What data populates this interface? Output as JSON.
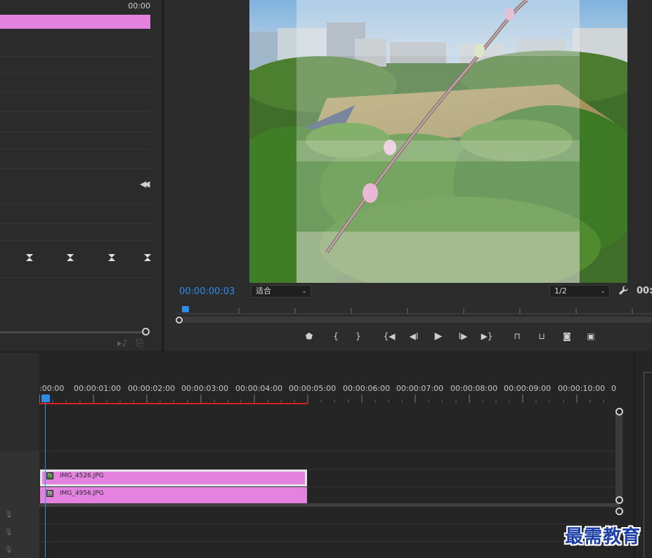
{
  "source_panel": {
    "timecode": "00:00"
  },
  "program_monitor": {
    "timecode": "00:00:00:03",
    "zoom": "适合",
    "resolution": "1/2",
    "duration_partial": "00:",
    "preview_image": "campus-sports-field-with-flower-branch-overlay",
    "transport_icons": [
      "add-marker-icon",
      "mark-in-icon",
      "mark-out-icon",
      "go-to-in-icon",
      "step-back-icon",
      "play-icon",
      "step-forward-icon",
      "go-to-out-icon",
      "lift-icon",
      "extract-icon",
      "export-frame-icon",
      "compare-view-icon"
    ]
  },
  "timeline": {
    "ruler_labels": [
      ":00:00",
      "00:00:01:00",
      "00:00:02:00",
      "00:00:03:00",
      "00:00:04:00",
      "00:00:05:00",
      "00:00:06:00",
      "00:00:07:00",
      "00:00:08:00",
      "00:00:09:00",
      "00:00:10:00",
      "0"
    ],
    "clips": [
      {
        "name": "IMG_4526.JPG",
        "color": "#e483df"
      },
      {
        "name": "IMG_4956.JPG",
        "color": "#e483df"
      }
    ],
    "playhead_color": "#2d8ceb",
    "render_bar_color": "#d62222"
  },
  "watermark": "最需教育"
}
